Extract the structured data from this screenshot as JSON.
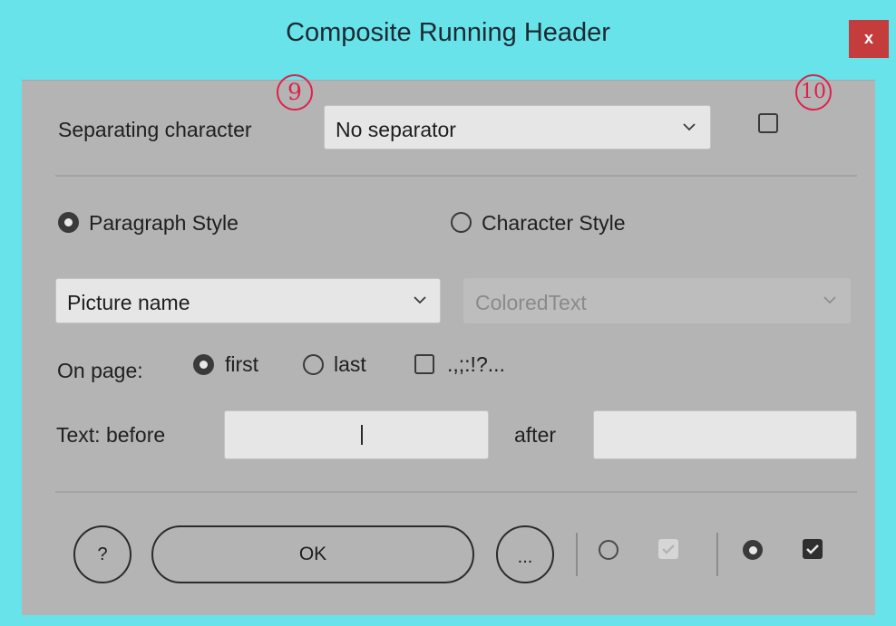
{
  "window": {
    "title": "Composite Running Header",
    "close_label": "x"
  },
  "annotations": {
    "badge_9": "9",
    "badge_10": "10"
  },
  "separator": {
    "label": "Separating character",
    "value": "No separator",
    "checkbox_checked": false
  },
  "style_mode": {
    "paragraph_label": "Paragraph Style",
    "character_label": "Character Style",
    "selected": "paragraph"
  },
  "paragraph_style_select": {
    "value": "Picture name"
  },
  "character_style_select": {
    "value": "ColoredText",
    "disabled": true
  },
  "on_page": {
    "label": "On page:",
    "first_label": "first",
    "last_label": "last",
    "punct_label": ".,;:!?...",
    "selected": "first",
    "punct_checked": false
  },
  "text": {
    "label": "Text: before",
    "before_value": "",
    "after_label": "after",
    "after_value": ""
  },
  "footer": {
    "help_label": "?",
    "ok_label": "OK",
    "more_label": "..."
  },
  "colors": {
    "window_border": "#69e3ea",
    "panel": "#b4b4b4",
    "close": "#c43c3c",
    "badge": "#e0204a"
  }
}
